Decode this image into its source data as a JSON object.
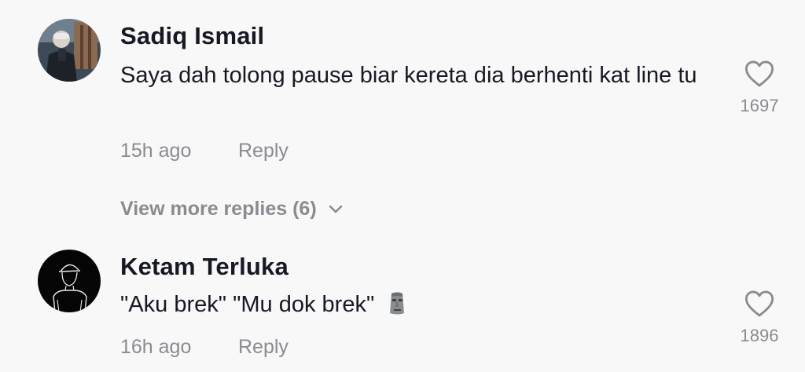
{
  "comments": [
    {
      "username": "Sadiq Ismail",
      "text": "Saya dah tolong pause biar kereta dia berhenti kat line tu",
      "time": "15h ago",
      "reply_label": "Reply",
      "like_count": "1697",
      "avatar_icon": "photo-avatar"
    },
    {
      "username": "Ketam Terluka",
      "text": "\"Aku brek\" \"Mu dok brek\"",
      "emoji": "moai-emoji",
      "time": "16h ago",
      "reply_label": "Reply",
      "like_count": "1896",
      "avatar_icon": "line-art-avatar"
    }
  ],
  "view_more": {
    "label": "View more replies (6)",
    "icon": "chevron-down-icon"
  },
  "colors": {
    "background": "#f8f8f8",
    "primary_text": "#161823",
    "secondary_text": "#8a8b91"
  }
}
